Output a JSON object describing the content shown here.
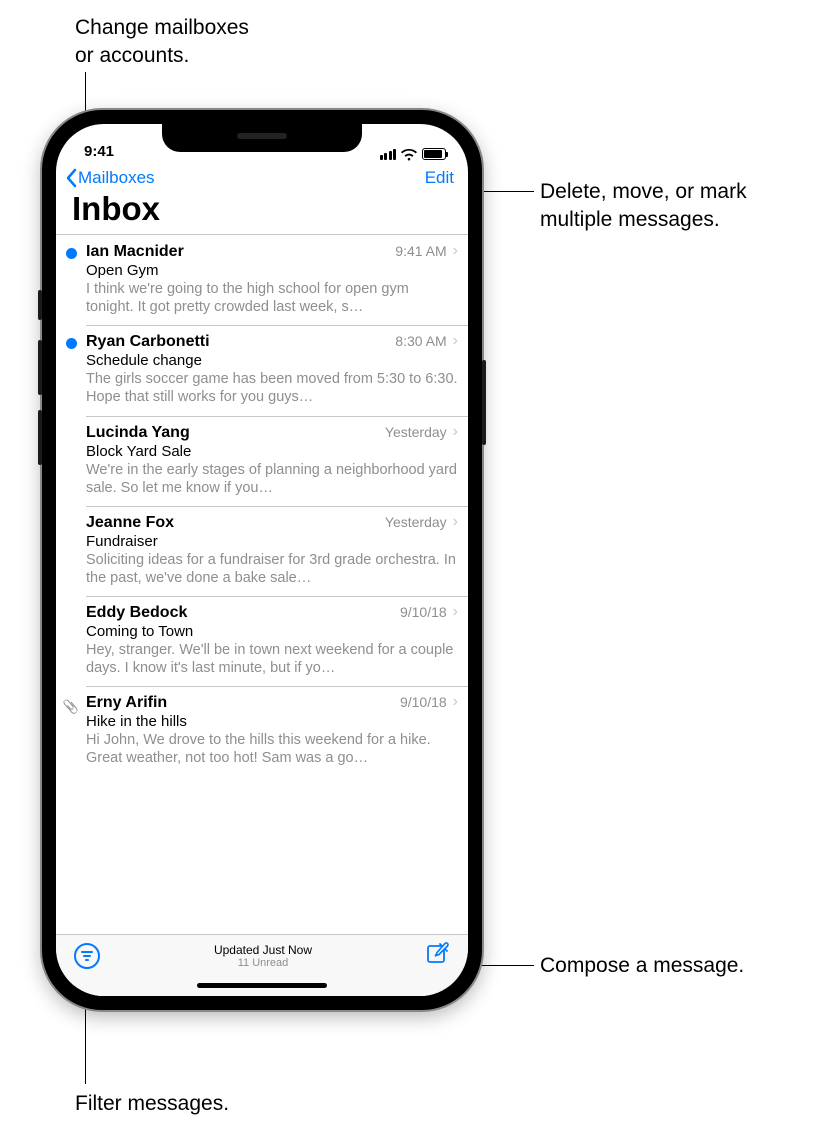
{
  "callouts": {
    "top_left": "Change mailboxes\nor accounts.",
    "top_right": "Delete, move, or mark\nmultiple messages.",
    "bottom_right": "Compose a message.",
    "bottom_left": "Filter messages."
  },
  "status": {
    "time": "9:41"
  },
  "nav": {
    "back_label": "Mailboxes",
    "edit_label": "Edit"
  },
  "title": "Inbox",
  "messages": [
    {
      "unread": true,
      "attachment": false,
      "sender": "Ian Macnider",
      "time": "9:41 AM",
      "subject": "Open Gym",
      "preview": "I think we're going to the high school for open gym tonight. It got pretty crowded last week, s…"
    },
    {
      "unread": true,
      "attachment": false,
      "sender": "Ryan Carbonetti",
      "time": "8:30 AM",
      "subject": "Schedule change",
      "preview": "The girls soccer game has been moved from 5:30 to 6:30. Hope that still works for you guys…"
    },
    {
      "unread": false,
      "attachment": false,
      "sender": "Lucinda Yang",
      "time": "Yesterday",
      "subject": "Block Yard Sale",
      "preview": "We're in the early stages of planning a neighborhood yard sale. So let me know if you…"
    },
    {
      "unread": false,
      "attachment": false,
      "sender": "Jeanne Fox",
      "time": "Yesterday",
      "subject": "Fundraiser",
      "preview": "Soliciting ideas for a fundraiser for 3rd grade orchestra. In the past, we've done a bake sale…"
    },
    {
      "unread": false,
      "attachment": false,
      "sender": "Eddy Bedock",
      "time": "9/10/18",
      "subject": "Coming to Town",
      "preview": "Hey, stranger. We'll be in town next weekend for a couple days. I know it's last minute, but if yo…"
    },
    {
      "unread": false,
      "attachment": true,
      "sender": "Erny Arifin",
      "time": "9/10/18",
      "subject": "Hike in the hills",
      "preview": "Hi John, We drove to the hills this weekend for a hike. Great weather, not too hot! Sam was a go…"
    }
  ],
  "toolbar": {
    "updated": "Updated Just Now",
    "unread": "11 Unread"
  }
}
